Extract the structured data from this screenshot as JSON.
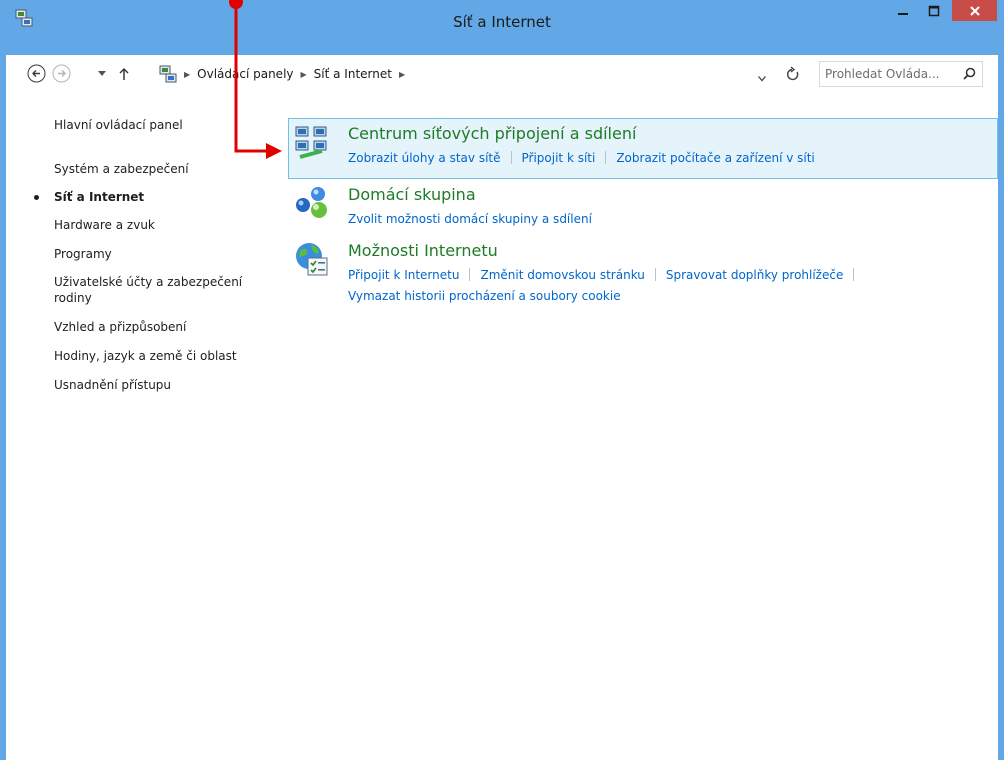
{
  "window": {
    "title": "Síť a Internet",
    "min_symbol": "–",
    "max_symbol": "☐",
    "close_symbol": "✕"
  },
  "nav": {
    "breadcrumb": [
      "Ovládací panely",
      "Síť a Internet"
    ],
    "search_placeholder": "Prohledat Ovláda..."
  },
  "sidebar": {
    "items": [
      {
        "label": "Hlavní ovládací panel",
        "active": false
      },
      {
        "label": "Systém a zabezpečení",
        "active": false
      },
      {
        "label": "Síť a Internet",
        "active": true
      },
      {
        "label": "Hardware a zvuk",
        "active": false
      },
      {
        "label": "Programy",
        "active": false
      },
      {
        "label": "Uživatelské účty a zabezpečení rodiny",
        "active": false
      },
      {
        "label": "Vzhled a přizpůsobení",
        "active": false
      },
      {
        "label": "Hodiny, jazyk a země či oblast",
        "active": false
      },
      {
        "label": "Usnadnění přístupu",
        "active": false
      }
    ]
  },
  "categories": [
    {
      "title": "Centrum síťových připojení a sdílení",
      "icon": "network-center-icon",
      "highlighted": true,
      "links": [
        "Zobrazit úlohy a stav sítě",
        "Připojit k síti",
        "Zobrazit počítače a zařízení v síti"
      ]
    },
    {
      "title": "Domácí skupina",
      "icon": "homegroup-icon",
      "highlighted": false,
      "links": [
        "Zvolit možnosti domácí skupiny a sdílení"
      ]
    },
    {
      "title": "Možnosti Internetu",
      "icon": "internet-options-icon",
      "highlighted": false,
      "links": [
        "Připojit k Internetu",
        "Změnit domovskou stránku",
        "Spravovat doplňky prohlížeče",
        "Vymazat historii procházení a soubory cookie"
      ]
    }
  ],
  "colors": {
    "frame": "#63a8e6",
    "category_title": "#1e7b26",
    "link": "#0066cc",
    "highlight_bg": "#e5f3fb",
    "highlight_border": "#70c0e7",
    "close_button": "#c84c47",
    "annotation": "#e00000"
  }
}
